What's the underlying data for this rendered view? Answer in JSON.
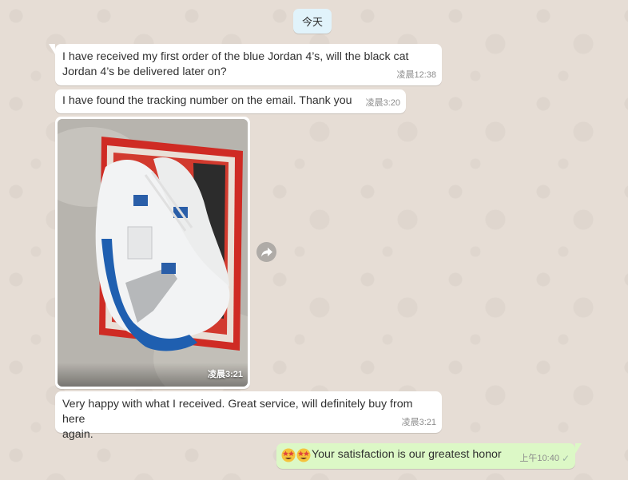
{
  "chat": {
    "day_label": "今天",
    "messages": [
      {
        "text": "I have received my first order of the blue Jordan 4’s, will the black cat\nJordan 4’s be delivered later on?",
        "time": "凌晨12:38"
      },
      {
        "text": "I have found the tracking number on the email. Thank you",
        "time": "凌晨3:20"
      },
      {
        "image_subject": "sneaker-photo",
        "time": "凌晨3:21"
      },
      {
        "text": "Very happy with what I received. Great service, will definitely buy from here\nagain.",
        "time": "凌晨3:21"
      }
    ],
    "outgoing": {
      "text": "Your satisfaction is our greatest honor",
      "time": "上午10:40",
      "status_icon": "single-check-icon",
      "emoji_icons": [
        "star-struck-emoji-icon",
        "star-struck-emoji-icon"
      ]
    }
  },
  "colors": {
    "wallpaper": "#e5ddd5",
    "incoming_bubble": "#ffffff",
    "outgoing_bubble": "#dcf8c6",
    "day_chip": "#e1f3fb",
    "timestamp": "#8c8c8c"
  }
}
